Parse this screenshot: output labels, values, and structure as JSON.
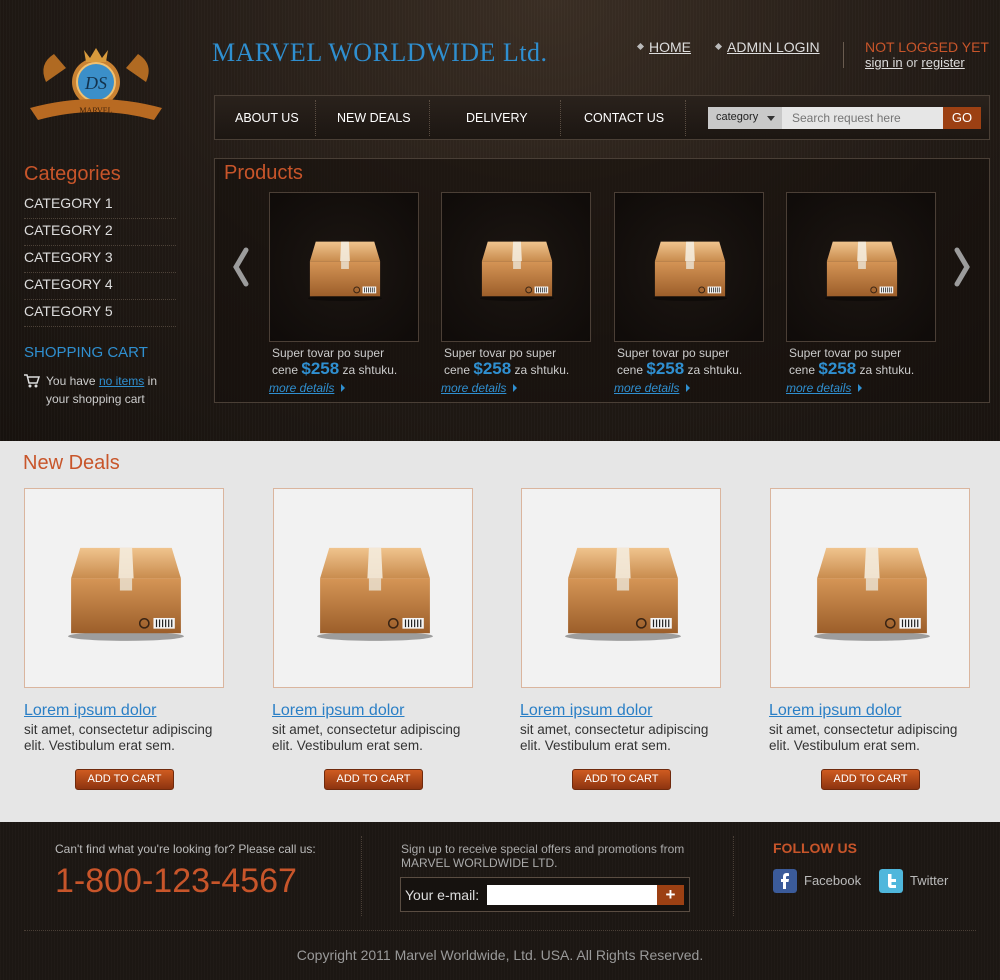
{
  "header": {
    "brand": "MARVEL WORLDWIDE Ltd.",
    "logo_monogram": "DS",
    "logo_banner": "MARVEL",
    "links": [
      {
        "label": "HOME"
      },
      {
        "label": "ADMIN LOGIN"
      }
    ],
    "status": "NOT LOGGED YET",
    "sign_in": "sign in",
    "or": "or",
    "register": "register"
  },
  "nav": {
    "items": [
      "ABOUT US",
      "NEW DEALS",
      "DELIVERY",
      "CONTACT US"
    ],
    "category_select": "category",
    "search_placeholder": "Search request here",
    "go_label": "GO"
  },
  "sidebar": {
    "categories_title": "Categories",
    "categories": [
      "CATEGORY 1",
      "CATEGORY 2",
      "CATEGORY 3",
      "CATEGORY 4",
      "CATEGORY 5"
    ],
    "cart_title": "SHOPPING CART",
    "cart_prefix": "You have",
    "cart_link": "no items",
    "cart_suffix": "in your shopping cart"
  },
  "products": {
    "title": "Products",
    "items": [
      {
        "name": "Super tovar po super",
        "pre": "cene",
        "price": "$258",
        "post": "za shtuku.",
        "more": "more details"
      },
      {
        "name": "Super tovar po super",
        "pre": "cene",
        "price": "$258",
        "post": "za shtuku.",
        "more": "more details"
      },
      {
        "name": "Super tovar po super",
        "pre": "cene",
        "price": "$258",
        "post": "za shtuku.",
        "more": "more details"
      },
      {
        "name": "Super tovar po super",
        "pre": "cene",
        "price": "$258",
        "post": "za shtuku.",
        "more": "more details"
      }
    ]
  },
  "deals": {
    "title": "New Deals",
    "items": [
      {
        "title": "Lorem ipsum dolor",
        "desc": "sit amet, consectetur adipiscing elit. Vestibulum erat sem.",
        "button": "ADD TO CART"
      },
      {
        "title": "Lorem ipsum dolor",
        "desc": "sit amet, consectetur adipiscing elit. Vestibulum erat sem.",
        "button": "ADD TO CART"
      },
      {
        "title": "Lorem ipsum dolor",
        "desc": "sit amet, consectetur adipiscing elit. Vestibulum erat sem.",
        "button": "ADD TO CART"
      },
      {
        "title": "Lorem ipsum dolor",
        "desc": "sit amet, consectetur adipiscing elit. Vestibulum erat sem.",
        "button": "ADD TO CART"
      }
    ]
  },
  "footer": {
    "call_text": "Can't find what you're looking for? Please call us:",
    "phone": "1-800-123-4567",
    "signup_text": "Sign up to receive special offers and promotions from MARVEL WORLDWIDE LTD.",
    "email_label": "Your e-mail:",
    "email_button": "+",
    "follow_title": "FOLLOW US",
    "social": [
      {
        "label": "Facebook",
        "icon": "facebook-icon"
      },
      {
        "label": "Twitter",
        "icon": "twitter-icon"
      }
    ],
    "copyright": "Copyright 2011 Marvel Worldwide, Ltd. USA. All Rights Reserved."
  },
  "colors": {
    "accent_orange": "#c8552a",
    "accent_blue": "#2f8fd0",
    "button_brown": "#9c4013"
  }
}
